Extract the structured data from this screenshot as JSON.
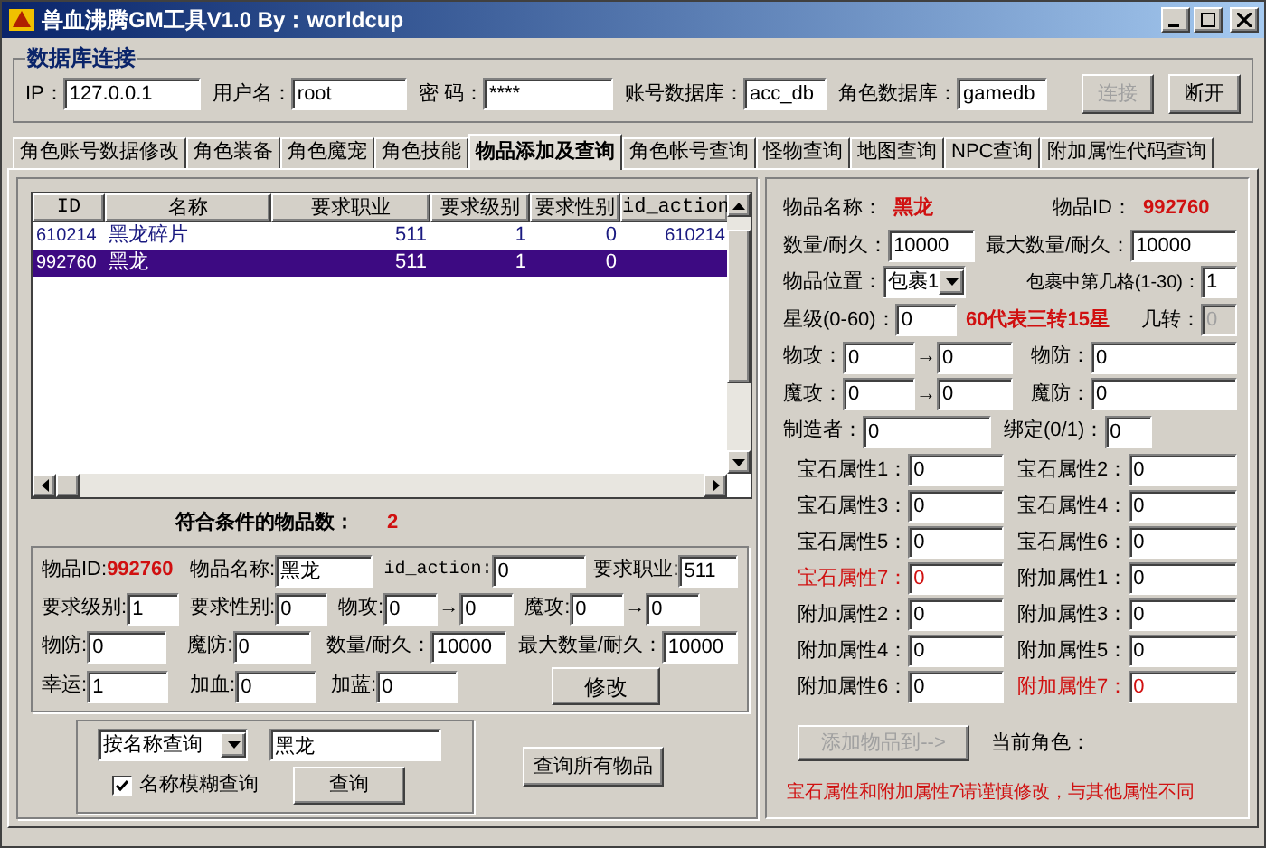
{
  "window": {
    "title": "兽血沸腾GM工具V1.0 By：worldcup"
  },
  "db_connection": {
    "title": "数据库连接",
    "fields": [
      {
        "label": "IP：",
        "value": "127.0.0.1"
      },
      {
        "label": "用户名：",
        "value": "root"
      },
      {
        "label": "密 码：",
        "value": "****"
      },
      {
        "label": "账号数据库：",
        "value": "acc_db"
      },
      {
        "label": "角色数据库：",
        "value": "gamedb"
      }
    ],
    "buttons": [
      {
        "label": "连接",
        "disabled": true
      },
      {
        "label": "断开",
        "disabled": false
      }
    ]
  },
  "tabs": [
    {
      "label": "角色账号数据修改",
      "selected": false
    },
    {
      "label": "角色装备",
      "selected": false
    },
    {
      "label": "角色魔宠",
      "selected": false
    },
    {
      "label": "角色技能",
      "selected": false
    },
    {
      "label": "物品添加及查询",
      "selected": true
    },
    {
      "label": "角色帐号查询",
      "selected": false
    },
    {
      "label": "怪物查询",
      "selected": false
    },
    {
      "label": "地图查询",
      "selected": false
    },
    {
      "label": "NPC查询",
      "selected": false
    },
    {
      "label": "附加属性代码查询",
      "selected": false
    }
  ],
  "results_table": {
    "columns": [
      "ID",
      "名称",
      "要求职业",
      "要求级别",
      "要求性别",
      "id_action"
    ],
    "rows": [
      {
        "cells": [
          "610214",
          "黑龙碎片",
          "511",
          "1",
          "0",
          "610214"
        ],
        "selected": false
      },
      {
        "cells": [
          "992760",
          "黑龙",
          "511",
          "1",
          "0"
        ],
        "selected": true
      }
    ]
  },
  "match_count": {
    "label": "符合条件的物品数：",
    "value": "2"
  },
  "item_edit": {
    "id": {
      "label": "物品ID:",
      "value": "992760"
    },
    "name": {
      "label": "物品名称:",
      "value": "黑龙"
    },
    "id_action": {
      "label": "id_action:",
      "value": "0"
    },
    "req_class": {
      "label": "要求职业:",
      "value": "511"
    },
    "req_level": {
      "label": "要求级别:",
      "value": "1"
    },
    "req_gender": {
      "label": "要求性别:",
      "value": "0"
    },
    "phys_attack": {
      "label": "物攻:",
      "min": "0",
      "arrow": "→",
      "max": "0"
    },
    "mag_attack": {
      "label": "魔攻:",
      "min": "0",
      "arrow": "→",
      "max": "0"
    },
    "phys_defense": {
      "label": "物防:",
      "value": "0"
    },
    "mag_defense": {
      "label": "魔防:",
      "value": "0"
    },
    "quantity": {
      "label": "数量/耐久：",
      "value": "10000"
    },
    "max_quantity": {
      "label": "最大数量/耐久：",
      "value": "10000"
    },
    "luck": {
      "label": "幸运:",
      "value": "1"
    },
    "hp": {
      "label": "加血:",
      "value": "0"
    },
    "mp": {
      "label": "加蓝:",
      "value": "0"
    },
    "modify_button": "修改"
  },
  "search": {
    "mode": "按名称查询",
    "value": "黑龙",
    "fuzzy": {
      "label": "名称模糊查询",
      "checked": true
    },
    "query_button": "查询",
    "all_button": "查询所有物品"
  },
  "item_detail": {
    "name": {
      "label": "物品名称：",
      "value": "黑龙"
    },
    "id": {
      "label": "物品ID：",
      "value": "992760"
    },
    "quantity": {
      "label": "数量/耐久：",
      "value": "10000"
    },
    "max_quantity": {
      "label": "最大数量/耐久：",
      "value": "10000"
    },
    "location": {
      "label": "物品位置：",
      "value": "包裹1"
    },
    "slot": {
      "label": "包裹中第几格(1-30)：",
      "value": "1"
    },
    "star": {
      "label": "星级(0-60)：",
      "value": "0"
    },
    "star_note": "60代表三转15星",
    "rebirth": {
      "label": "几转：",
      "value": "0",
      "disabled": true
    },
    "phys_attack": {
      "label": "物攻：",
      "min": "0",
      "arrow": "→",
      "max": "0"
    },
    "phys_defense": {
      "label": "物防：",
      "value": "0"
    },
    "mag_attack": {
      "label": "魔攻：",
      "min": "0",
      "arrow": "→",
      "max": "0"
    },
    "mag_defense": {
      "label": "魔防：",
      "value": "0"
    },
    "maker": {
      "label": "制造者：",
      "value": "0"
    },
    "bound": {
      "label": "绑定(0/1)：",
      "value": "0"
    },
    "attributes": [
      {
        "label": "宝石属性1：",
        "value": "0",
        "warn": false
      },
      {
        "label": "宝石属性2：",
        "value": "0",
        "warn": false
      },
      {
        "label": "宝石属性3：",
        "value": "0",
        "warn": false
      },
      {
        "label": "宝石属性4：",
        "value": "0",
        "warn": false
      },
      {
        "label": "宝石属性5：",
        "value": "0",
        "warn": false
      },
      {
        "label": "宝石属性6：",
        "value": "0",
        "warn": false
      },
      {
        "label": "宝石属性7：",
        "value": "0",
        "warn": true
      },
      {
        "label": "附加属性1：",
        "value": "0",
        "warn": false
      },
      {
        "label": "附加属性2：",
        "value": "0",
        "warn": false
      },
      {
        "label": "附加属性3：",
        "value": "0",
        "warn": false
      },
      {
        "label": "附加属性4：",
        "value": "0",
        "warn": false
      },
      {
        "label": "附加属性5：",
        "value": "0",
        "warn": false
      },
      {
        "label": "附加属性6：",
        "value": "0",
        "warn": false
      },
      {
        "label": "附加属性7：",
        "value": "0",
        "warn": true
      }
    ],
    "add_button": {
      "label": "添加物品到-->",
      "disabled": true
    },
    "current_role": "当前角色：",
    "warning": "宝石属性和附加属性7请谨慎修改，与其他属性不同"
  }
}
